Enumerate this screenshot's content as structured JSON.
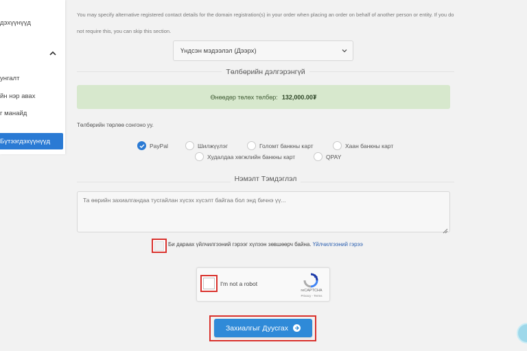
{
  "sidebar": {
    "items": [
      {
        "label": "дэхүүнүүд"
      },
      {
        "label": "унгалт"
      },
      {
        "label": "йн нэр авах"
      },
      {
        "label": "г манайд"
      }
    ],
    "active_item": {
      "label": "Бүтээгдэхүүнүүд"
    }
  },
  "contact": {
    "note": "You may specify alternative registered contact details for the domain registration(s) in your order when placing an order on behalf of another person or entity. If you do not require this, you can skip this section.",
    "select_value": "Үндсэн мэдээлэл (Дээрх)"
  },
  "payment": {
    "section_title": "Төлбөрийн дэлгэрэнгүй",
    "total_label": "Өнөөдөр төлөх төлбөр:",
    "total_amount": "132,000.00₮",
    "method_prompt": "Төлбөрийн төрлөө сонгоно уу.",
    "methods": [
      {
        "label": "PayPal",
        "selected": true
      },
      {
        "label": "Шилжүүлэг",
        "selected": false
      },
      {
        "label": "Голомт банкны карт",
        "selected": false
      },
      {
        "label": "Хаан банкны карт",
        "selected": false
      },
      {
        "label": "Худалдаа хөгжлийн банкны карт",
        "selected": false
      },
      {
        "label": "QPAY",
        "selected": false
      }
    ]
  },
  "notes": {
    "section_title": "Нэмэлт Тэмдэглэл",
    "placeholder": "Та өөрийн захиалгандаа тусгайлан хүсэх хүсэлт байгаа бол энд бичнэ үү..."
  },
  "terms": {
    "text": "Би дараах үйлчилгээний гэрээг хүлээн зөвшөөрч байна.",
    "link": "Үйлчилгээний гэрээ"
  },
  "recaptcha": {
    "label": "I'm not a robot",
    "brand": "reCAPTCHA",
    "privacy": "Privacy - Terms"
  },
  "submit": {
    "label": "Захиалгыг Дуусгах"
  },
  "colors": {
    "accent": "#2a7ad4",
    "button": "#2f8ad8",
    "highlight": "#d9302b",
    "success_bg": "#d7e8cd"
  }
}
